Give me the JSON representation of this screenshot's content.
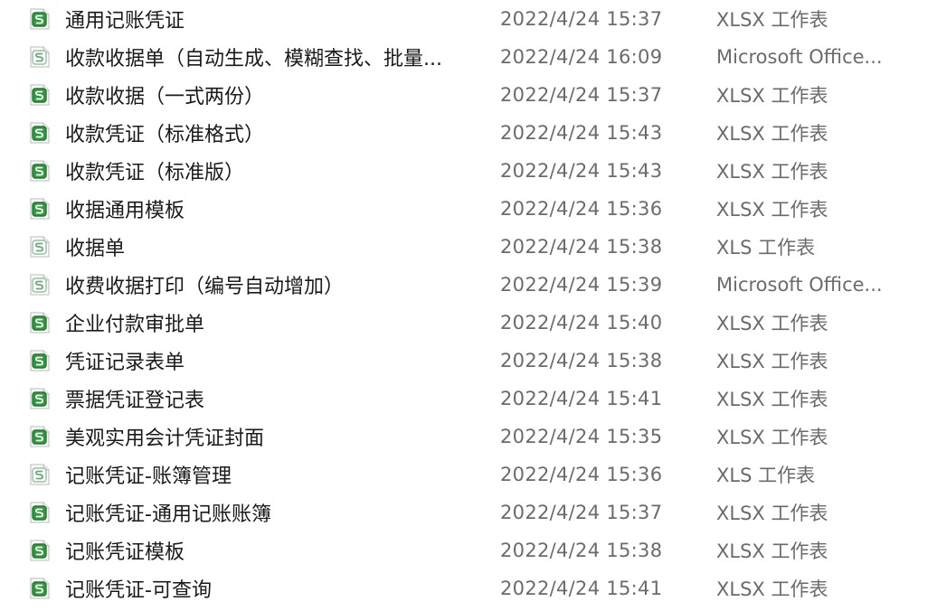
{
  "colors": {
    "xlsx_icon_fill": "#2e9a3e",
    "xls_icon_fill": "#ffffff",
    "xls_icon_stroke": "#8dc59a",
    "text_primary": "#1a1a1a",
    "text_secondary": "#6b6b6b"
  },
  "files": [
    {
      "name": "通用记账凭证",
      "modified": "2022/4/24 15:37",
      "type": "XLSX 工作表",
      "icon": "xlsx-file-icon"
    },
    {
      "name": "收款收据单（自动生成、模糊查找、批量...",
      "modified": "2022/4/24 16:09",
      "type": "Microsoft Office...",
      "icon": "xls-file-icon"
    },
    {
      "name": "收款收据（一式两份）",
      "modified": "2022/4/24 15:37",
      "type": "XLSX 工作表",
      "icon": "xlsx-file-icon"
    },
    {
      "name": "收款凭证（标准格式）",
      "modified": "2022/4/24 15:43",
      "type": "XLSX 工作表",
      "icon": "xlsx-file-icon"
    },
    {
      "name": "收款凭证（标准版）",
      "modified": "2022/4/24 15:43",
      "type": "XLSX 工作表",
      "icon": "xlsx-file-icon"
    },
    {
      "name": "收据通用模板",
      "modified": "2022/4/24 15:36",
      "type": "XLSX 工作表",
      "icon": "xlsx-file-icon"
    },
    {
      "name": "收据单",
      "modified": "2022/4/24 15:38",
      "type": "XLS 工作表",
      "icon": "xls-file-icon"
    },
    {
      "name": "收费收据打印（编号自动增加）",
      "modified": "2022/4/24 15:39",
      "type": "Microsoft Office...",
      "icon": "xls-file-icon"
    },
    {
      "name": "企业付款审批单",
      "modified": "2022/4/24 15:40",
      "type": "XLSX 工作表",
      "icon": "xlsx-file-icon"
    },
    {
      "name": "凭证记录表单",
      "modified": "2022/4/24 15:38",
      "type": "XLSX 工作表",
      "icon": "xlsx-file-icon"
    },
    {
      "name": "票据凭证登记表",
      "modified": "2022/4/24 15:41",
      "type": "XLSX 工作表",
      "icon": "xlsx-file-icon"
    },
    {
      "name": "美观实用会计凭证封面",
      "modified": "2022/4/24 15:35",
      "type": "XLSX 工作表",
      "icon": "xlsx-file-icon"
    },
    {
      "name": "记账凭证-账簿管理",
      "modified": "2022/4/24 15:36",
      "type": "XLS 工作表",
      "icon": "xls-file-icon"
    },
    {
      "name": "记账凭证-通用记账账簿",
      "modified": "2022/4/24 15:37",
      "type": "XLSX 工作表",
      "icon": "xlsx-file-icon"
    },
    {
      "name": "记账凭证模板",
      "modified": "2022/4/24 15:38",
      "type": "XLSX 工作表",
      "icon": "xlsx-file-icon"
    },
    {
      "name": "记账凭证-可查询",
      "modified": "2022/4/24 15:41",
      "type": "XLSX 工作表",
      "icon": "xlsx-file-icon"
    }
  ]
}
